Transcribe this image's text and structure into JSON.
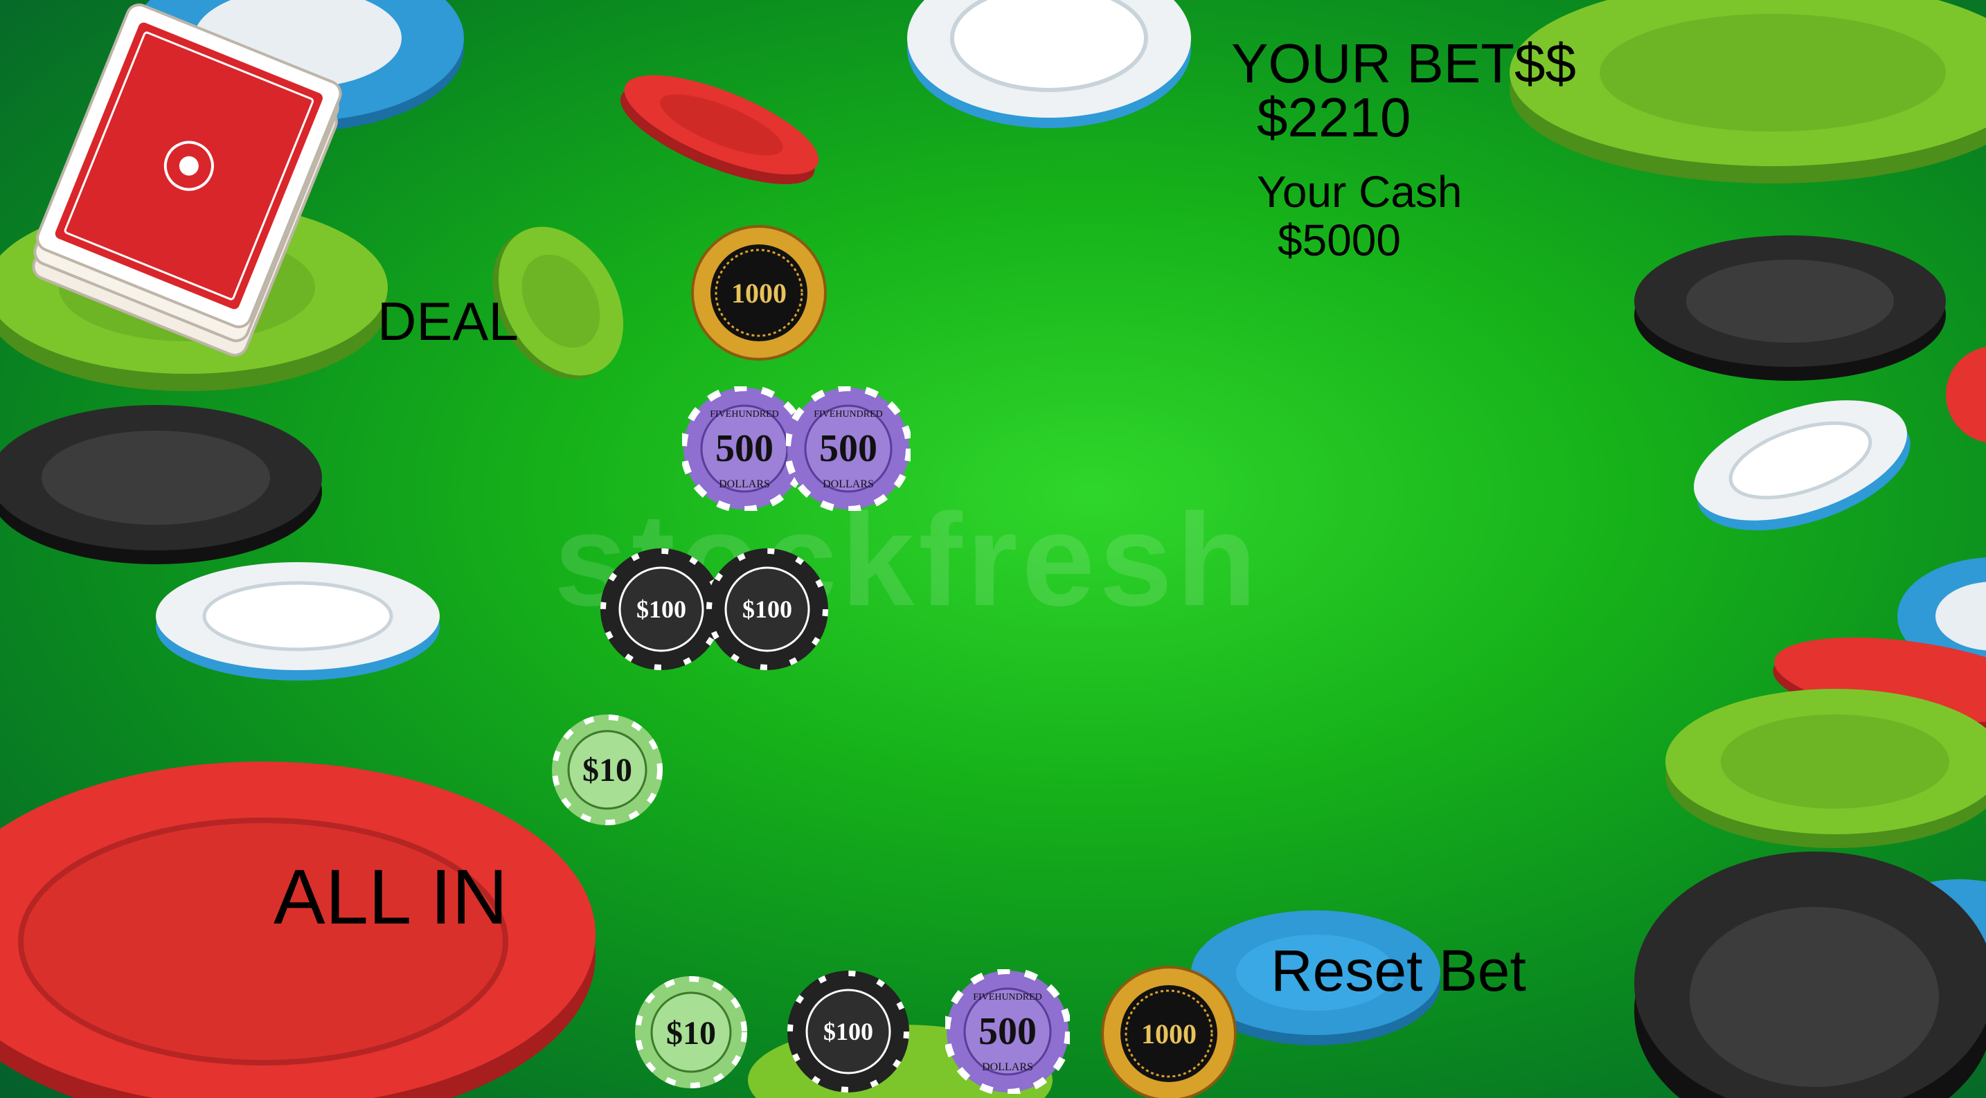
{
  "bets": {
    "title": "YOUR BET$$",
    "amount": "$2210"
  },
  "cash": {
    "label": "Your Cash",
    "amount": "$5000"
  },
  "buttons": {
    "deal": "DEAL",
    "all_in": "ALL IN",
    "reset": "Reset Bet"
  },
  "watermark": "stockfresh",
  "bet_stack": [
    {
      "denom": "1000",
      "count": 1
    },
    {
      "denom": "500",
      "count": 2
    },
    {
      "denom": "100",
      "count": 2
    },
    {
      "denom": "10",
      "count": 1
    }
  ],
  "chip_tray": [
    {
      "denom": "10",
      "label": "$10"
    },
    {
      "denom": "100",
      "label": "$100"
    },
    {
      "denom": "500",
      "label": "500",
      "sub_top": "FIVEHUNDRED",
      "sub_bottom": "DOLLARS"
    },
    {
      "denom": "1000",
      "label": "1000"
    }
  ],
  "chip_text": {
    "c1000": "1000",
    "c500": "500",
    "c500_top": "FIVEHUNDRED",
    "c500_bottom": "DOLLARS",
    "c100": "$100",
    "c10": "$10"
  },
  "colors": {
    "felt": "#16b11a",
    "chip_red": "#e5332f",
    "chip_green": "#7cc62b",
    "chip_blue": "#2f9ad6",
    "chip_black": "#2a2a2a",
    "chip_purple": "#8f6fcf",
    "chip_gold": "#d8a12a"
  }
}
